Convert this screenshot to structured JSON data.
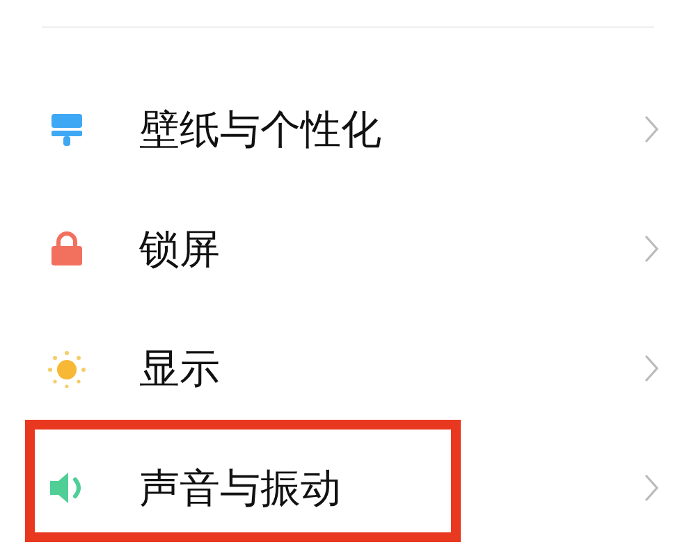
{
  "items": [
    {
      "kind": "brush",
      "label": "壁纸与个性化",
      "highlighted": false
    },
    {
      "kind": "lock",
      "label": "锁屏",
      "highlighted": false
    },
    {
      "kind": "sun",
      "label": "显示",
      "highlighted": false
    },
    {
      "kind": "speaker",
      "label": "声音与振动",
      "highlighted": true
    }
  ]
}
